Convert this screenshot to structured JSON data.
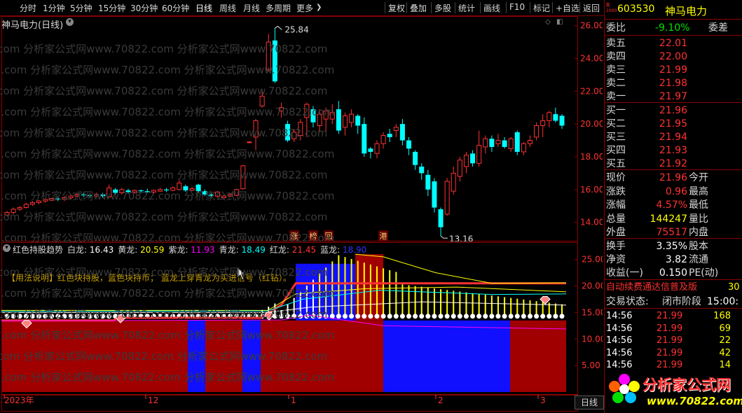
{
  "toolbar": {
    "periods": [
      "分时",
      "1分钟",
      "5分钟",
      "15分钟",
      "30分钟",
      "60分钟",
      "日线",
      "周线",
      "月线",
      "多周期",
      "更多"
    ],
    "active_period": "日线",
    "more_arrow": "❯",
    "tools": [
      "复权",
      "叠加",
      "多股",
      "统计",
      "画线",
      "F10",
      "标记",
      "+自选",
      "返回"
    ]
  },
  "main": {
    "title": "神马电力(日线)",
    "y_axis": [
      "26.00",
      "24.00",
      "22.00",
      "20.00",
      "18.00",
      "16.00",
      "14.00"
    ],
    "high_label": "25.84",
    "low_label": "13.16",
    "event_tags": [
      "涨",
      "榜",
      "回",
      "港"
    ],
    "watermark": "分析家公式网www.70822.com 分析家公式网www.70822.com",
    "watermark_domain": "2.com"
  },
  "indicator": {
    "name": "红色持股趋势",
    "values": [
      {
        "label": "白龙:",
        "value": "16.43",
        "color": "#ffffff"
      },
      {
        "label": "黄龙:",
        "value": "20.59",
        "color": "#ffff00"
      },
      {
        "label": "紫龙:",
        "value": "11.93",
        "color": "#ff00ff"
      },
      {
        "label": "青龙:",
        "value": "18.49",
        "color": "#00ffff"
      },
      {
        "label": "红龙:",
        "value": "21.45",
        "color": "#ff3232"
      },
      {
        "label": "蓝龙:",
        "value": "18.90",
        "color": "#3232ff"
      }
    ],
    "usage": "【用法说明】红色块持股，蓝色块持币；  蓝龙上穿青龙为买进信号（红钻）。",
    "y_axis": [
      "25.00",
      "20.00",
      "15.00",
      "10.00",
      "5.00"
    ]
  },
  "time_axis": {
    "labels": [
      "2023年",
      "12",
      "1",
      "2",
      "3"
    ],
    "period": "日线"
  },
  "quote": {
    "badge_r": "R",
    "badge_n": "1000",
    "code": "603530",
    "name": "神马电力",
    "weibi_label": "委比",
    "weibi_value": "-9.10%",
    "weicha_label": "委差",
    "asks": [
      {
        "label": "卖五",
        "price": "22.01"
      },
      {
        "label": "卖四",
        "price": "22.00"
      },
      {
        "label": "卖三",
        "price": "21.99"
      },
      {
        "label": "卖二",
        "price": "21.98"
      },
      {
        "label": "卖一",
        "price": "21.97"
      }
    ],
    "bids": [
      {
        "label": "买一",
        "price": "21.96"
      },
      {
        "label": "买二",
        "price": "21.95"
      },
      {
        "label": "买三",
        "price": "21.94"
      },
      {
        "label": "买四",
        "price": "21.93"
      },
      {
        "label": "买五",
        "price": "21.92"
      }
    ],
    "stats": [
      {
        "label": "现价",
        "value": "21.96",
        "color": "#ff3232",
        "label2": "今开"
      },
      {
        "label": "涨跌",
        "value": "0.96",
        "color": "#ff3232",
        "label2": "最高"
      },
      {
        "label": "涨幅",
        "value": "4.57%",
        "color": "#ff3232",
        "label2": "最低"
      },
      {
        "label": "总量",
        "value": "144247",
        "color": "#ffff00",
        "label2": "量比"
      },
      {
        "label": "外盘",
        "value": "75517",
        "color": "#ff3232",
        "label2": "内盘"
      }
    ],
    "stats2": [
      {
        "label": "换手",
        "value": "3.35%",
        "label2": "股本"
      },
      {
        "label": "净资",
        "value": "3.82",
        "label2": "流通"
      },
      {
        "label": "收益(一)",
        "value": "0.150",
        "label2": "PE(动)"
      }
    ],
    "promo": "自动续费通达信普及版",
    "promo_num": "30",
    "status_label": "交易状态:",
    "status_value": "闭市阶段",
    "status_time": "15:00:",
    "ticks": [
      {
        "time": "14:56",
        "price": "21.99",
        "vol": "168"
      },
      {
        "time": "14:56",
        "price": "21.99",
        "vol": "69"
      },
      {
        "time": "14:56",
        "price": "21.99",
        "vol": "22"
      },
      {
        "time": "14:56",
        "price": "21.99",
        "vol": "42"
      },
      {
        "time": "14:56",
        "price": "21.99",
        "vol": "14"
      }
    ],
    "logo_cn": "分析家公式网",
    "logo_url": "www.70822.com"
  },
  "chart_data": {
    "type": "candlestick",
    "title": "神马电力(日线)",
    "ylim": [
      13.0,
      26.5
    ],
    "candles": [
      {
        "o": 14.45,
        "c": 14.6,
        "h": 14.7,
        "l": 14.35
      },
      {
        "o": 14.6,
        "c": 14.8,
        "h": 14.9,
        "l": 14.5
      },
      {
        "o": 14.8,
        "c": 14.9,
        "h": 15.0,
        "l": 14.7
      },
      {
        "o": 14.9,
        "c": 15.1,
        "h": 15.2,
        "l": 14.85
      },
      {
        "o": 15.1,
        "c": 15.2,
        "h": 15.3,
        "l": 15.0
      },
      {
        "o": 15.2,
        "c": 15.3,
        "h": 15.35,
        "l": 15.1
      },
      {
        "o": 15.3,
        "c": 15.4,
        "h": 15.45,
        "l": 15.2
      },
      {
        "o": 15.35,
        "c": 15.45,
        "h": 15.5,
        "l": 15.3
      },
      {
        "o": 15.45,
        "c": 15.4,
        "h": 15.5,
        "l": 15.3
      },
      {
        "o": 15.4,
        "c": 15.5,
        "h": 15.6,
        "l": 15.3
      },
      {
        "o": 15.5,
        "c": 15.6,
        "h": 15.7,
        "l": 15.4
      },
      {
        "o": 15.6,
        "c": 15.7,
        "h": 15.75,
        "l": 15.5
      },
      {
        "o": 15.7,
        "c": 15.65,
        "h": 15.8,
        "l": 15.55
      },
      {
        "o": 15.65,
        "c": 15.6,
        "h": 15.75,
        "l": 15.5
      },
      {
        "o": 15.6,
        "c": 15.7,
        "h": 15.8,
        "l": 15.55
      },
      {
        "o": 15.7,
        "c": 15.6,
        "h": 15.8,
        "l": 15.5
      },
      {
        "o": 15.55,
        "c": 16.1,
        "h": 16.3,
        "l": 15.5
      },
      {
        "o": 16.0,
        "c": 15.8,
        "h": 16.1,
        "l": 15.7
      },
      {
        "o": 15.8,
        "c": 16.0,
        "h": 16.1,
        "l": 15.7
      },
      {
        "o": 15.95,
        "c": 15.85,
        "h": 16.05,
        "l": 15.75
      },
      {
        "o": 15.85,
        "c": 15.95,
        "h": 16.0,
        "l": 15.75
      },
      {
        "o": 15.95,
        "c": 15.9,
        "h": 16.0,
        "l": 15.8
      },
      {
        "o": 15.9,
        "c": 15.85,
        "h": 16.05,
        "l": 15.8
      },
      {
        "o": 15.85,
        "c": 15.95,
        "h": 16.0,
        "l": 15.75
      },
      {
        "o": 15.9,
        "c": 16.0,
        "h": 16.1,
        "l": 15.85
      },
      {
        "o": 16.0,
        "c": 15.95,
        "h": 16.1,
        "l": 15.85
      },
      {
        "o": 15.95,
        "c": 16.1,
        "h": 16.2,
        "l": 15.9
      },
      {
        "o": 16.0,
        "c": 16.4,
        "h": 16.6,
        "l": 15.95
      },
      {
        "o": 16.2,
        "c": 15.95,
        "h": 16.3,
        "l": 15.85
      },
      {
        "o": 15.95,
        "c": 16.05,
        "h": 16.15,
        "l": 15.9
      },
      {
        "o": 16.3,
        "c": 15.9,
        "h": 16.35,
        "l": 15.8
      },
      {
        "o": 15.9,
        "c": 15.7,
        "h": 16.0,
        "l": 15.6
      },
      {
        "o": 15.7,
        "c": 15.6,
        "h": 15.8,
        "l": 15.45
      },
      {
        "o": 15.6,
        "c": 15.85,
        "h": 15.9,
        "l": 15.5
      },
      {
        "o": 15.5,
        "c": 15.6,
        "h": 15.65,
        "l": 15.4
      },
      {
        "o": 15.6,
        "c": 15.7,
        "h": 15.8,
        "l": 15.55
      },
      {
        "o": 15.65,
        "c": 16.0,
        "h": 16.05,
        "l": 15.6
      },
      {
        "o": 16.05,
        "c": 17.45,
        "h": 17.5,
        "l": 16.0
      },
      {
        "o": 18.9,
        "c": 18.9,
        "h": 18.95,
        "l": 18.85
      },
      {
        "o": 19.2,
        "c": 20.2,
        "h": 20.3,
        "l": 18.4
      },
      {
        "o": 21.1,
        "c": 21.7,
        "h": 22.1,
        "l": 21.0
      },
      {
        "o": 23.3,
        "c": 25.0,
        "h": 25.5,
        "l": 23.2
      },
      {
        "o": 25.1,
        "c": 22.6,
        "h": 25.84,
        "l": 22.5
      },
      {
        "o": 20.8,
        "c": 21.0,
        "h": 21.3,
        "l": 20.4
      },
      {
        "o": 20.0,
        "c": 19.0,
        "h": 20.2,
        "l": 18.9
      },
      {
        "o": 19.1,
        "c": 19.5,
        "h": 19.7,
        "l": 18.9
      },
      {
        "o": 19.3,
        "c": 20.1,
        "h": 20.3,
        "l": 19.0
      },
      {
        "o": 20.4,
        "c": 21.2,
        "h": 21.3,
        "l": 19.2
      },
      {
        "o": 20.9,
        "c": 20.1,
        "h": 21.1,
        "l": 19.8
      },
      {
        "o": 19.9,
        "c": 20.6,
        "h": 20.9,
        "l": 19.5
      },
      {
        "o": 20.3,
        "c": 20.8,
        "h": 21.0,
        "l": 19.5
      },
      {
        "o": 20.3,
        "c": 20.7,
        "h": 21.2,
        "l": 20.0
      },
      {
        "o": 20.9,
        "c": 19.6,
        "h": 21.4,
        "l": 19.4
      },
      {
        "o": 19.8,
        "c": 20.5,
        "h": 20.7,
        "l": 19.3
      },
      {
        "o": 20.1,
        "c": 20.6,
        "h": 20.9,
        "l": 19.8
      },
      {
        "o": 20.5,
        "c": 19.9,
        "h": 20.6,
        "l": 19.4
      },
      {
        "o": 20.0,
        "c": 18.2,
        "h": 20.4,
        "l": 18.0
      },
      {
        "o": 18.5,
        "c": 18.3,
        "h": 18.6,
        "l": 17.9
      },
      {
        "o": 18.2,
        "c": 18.8,
        "h": 19.0,
        "l": 17.9
      },
      {
        "o": 18.8,
        "c": 19.3,
        "h": 19.5,
        "l": 18.5
      },
      {
        "o": 19.4,
        "c": 19.2,
        "h": 19.7,
        "l": 18.9
      },
      {
        "o": 19.6,
        "c": 19.8,
        "h": 20.0,
        "l": 19.2
      },
      {
        "o": 20.0,
        "c": 19.0,
        "h": 20.3,
        "l": 18.7
      },
      {
        "o": 19.0,
        "c": 18.5,
        "h": 19.2,
        "l": 18.1
      },
      {
        "o": 18.3,
        "c": 17.5,
        "h": 18.4,
        "l": 17.2
      },
      {
        "o": 17.4,
        "c": 17.0,
        "h": 17.6,
        "l": 16.6
      },
      {
        "o": 16.9,
        "c": 16.0,
        "h": 17.2,
        "l": 15.6
      },
      {
        "o": 16.5,
        "c": 14.9,
        "h": 16.7,
        "l": 14.6
      },
      {
        "o": 14.8,
        "c": 13.7,
        "h": 14.9,
        "l": 13.16
      },
      {
        "o": 14.5,
        "c": 16.5,
        "h": 16.7,
        "l": 14.4
      },
      {
        "o": 15.9,
        "c": 17.0,
        "h": 17.4,
        "l": 15.7
      },
      {
        "o": 16.8,
        "c": 17.8,
        "h": 18.0,
        "l": 16.5
      },
      {
        "o": 17.4,
        "c": 18.1,
        "h": 18.3,
        "l": 17.0
      },
      {
        "o": 18.2,
        "c": 17.6,
        "h": 18.4,
        "l": 17.4
      },
      {
        "o": 17.6,
        "c": 18.7,
        "h": 19.6,
        "l": 17.4
      },
      {
        "o": 18.6,
        "c": 19.1,
        "h": 19.3,
        "l": 18.2
      },
      {
        "o": 19.1,
        "c": 18.6,
        "h": 19.3,
        "l": 18.3
      },
      {
        "o": 18.8,
        "c": 19.0,
        "h": 19.4,
        "l": 18.6
      },
      {
        "o": 19.0,
        "c": 18.6,
        "h": 19.2,
        "l": 18.5
      },
      {
        "o": 18.5,
        "c": 19.1,
        "h": 19.2,
        "l": 18.3
      },
      {
        "o": 19.5,
        "c": 18.3,
        "h": 19.6,
        "l": 18.1
      },
      {
        "o": 18.3,
        "c": 18.8,
        "h": 18.9,
        "l": 18.1
      },
      {
        "o": 18.8,
        "c": 19.0,
        "h": 19.3,
        "l": 18.6
      },
      {
        "o": 19.2,
        "c": 19.9,
        "h": 20.1,
        "l": 19.0
      },
      {
        "o": 19.9,
        "c": 20.2,
        "h": 20.6,
        "l": 19.2
      },
      {
        "o": 20.2,
        "c": 20.7,
        "h": 20.8,
        "l": 19.8
      },
      {
        "o": 20.6,
        "c": 20.2,
        "h": 21.0,
        "l": 20.1
      },
      {
        "o": 20.5,
        "c": 19.9,
        "h": 20.6,
        "l": 19.7
      }
    ]
  }
}
